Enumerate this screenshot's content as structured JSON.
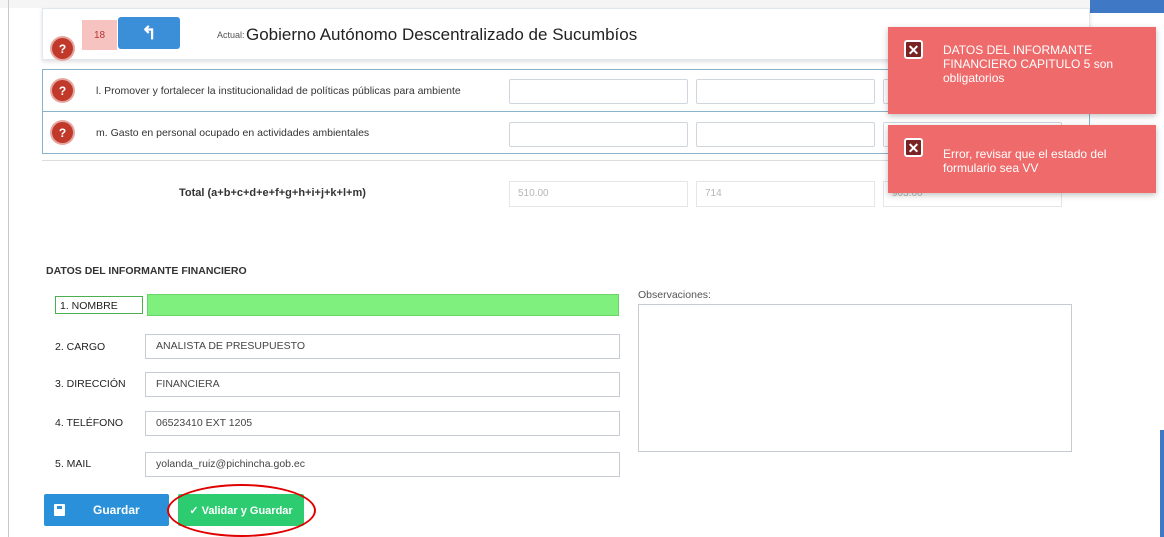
{
  "header": {
    "record_number": "18",
    "back_icon": "back-arrow-icon",
    "actual_label": "Actual:",
    "actual_name": "Gobierno Autónomo Descentralizado de Sucumbíos"
  },
  "rows": [
    {
      "badge": "?",
      "text": "l. Promover y fortalecer la institucionalidad de políticas públicas para ambiente"
    },
    {
      "badge": "?",
      "text": "m. Gasto en personal ocupado en actividades ambientales"
    }
  ],
  "totals": {
    "label": "Total (a+b+c+d+e+f+g+h+i+j+k+l+m)",
    "values": [
      "510.00",
      "714",
      "903.00"
    ]
  },
  "informante": {
    "title": "DATOS DEL INFORMANTE FINANCIERO",
    "fields": [
      {
        "label": "1. NOMBRE",
        "value": ""
      },
      {
        "label": "2. CARGO",
        "value": "ANALISTA DE PRESUPUESTO"
      },
      {
        "label": "3. DIRECCIÓN",
        "value": "FINANCIERA"
      },
      {
        "label": "4. TELÉFONO",
        "value": "06523410 EXT 1205"
      },
      {
        "label": "5. MAIL",
        "value": "yolanda_ruiz@pichincha.gob.ec"
      }
    ],
    "observaciones_label": "Observaciones:"
  },
  "buttons": {
    "guardar": "Guardar",
    "validar": "✓ Validar y Guardar"
  },
  "toasts": [
    {
      "icon": "close-icon",
      "message": "DATOS DEL INFORMANTE FINANCIERO CAPITULO 5 son obligatorios"
    },
    {
      "icon": "close-icon",
      "message": "Error, revisar que el estado del formulario sea VV"
    }
  ],
  "colors": {
    "toast_bg": "#ef6b6b",
    "primary_blue": "#2a90d9",
    "success_green": "#2ecc71",
    "highlight_green": "#7ff07e",
    "badge_red": "#c0392b"
  }
}
